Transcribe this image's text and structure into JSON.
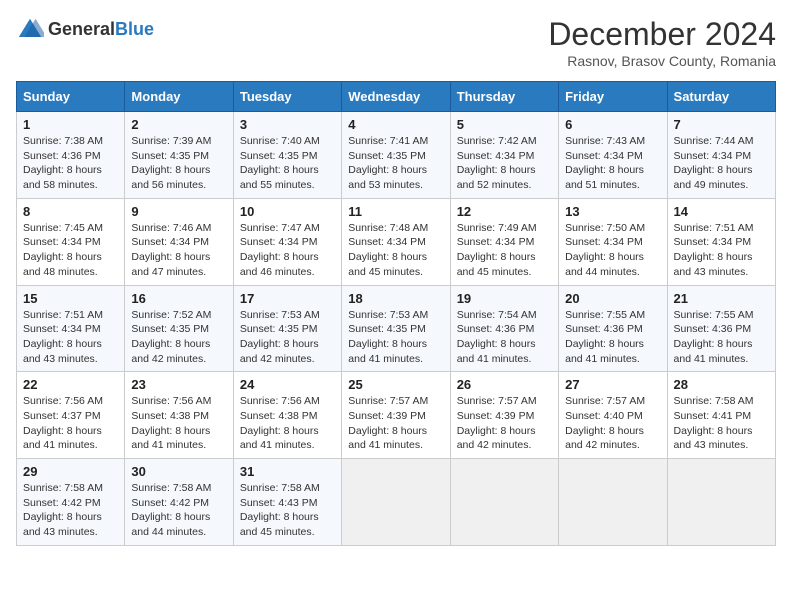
{
  "header": {
    "logo_general": "General",
    "logo_blue": "Blue",
    "month_title": "December 2024",
    "subtitle": "Rasnov, Brasov County, Romania"
  },
  "days_of_week": [
    "Sunday",
    "Monday",
    "Tuesday",
    "Wednesday",
    "Thursday",
    "Friday",
    "Saturday"
  ],
  "weeks": [
    [
      {
        "day": "1",
        "sunrise": "7:38 AM",
        "sunset": "4:36 PM",
        "daylight": "8 hours and 58 minutes."
      },
      {
        "day": "2",
        "sunrise": "7:39 AM",
        "sunset": "4:35 PM",
        "daylight": "8 hours and 56 minutes."
      },
      {
        "day": "3",
        "sunrise": "7:40 AM",
        "sunset": "4:35 PM",
        "daylight": "8 hours and 55 minutes."
      },
      {
        "day": "4",
        "sunrise": "7:41 AM",
        "sunset": "4:35 PM",
        "daylight": "8 hours and 53 minutes."
      },
      {
        "day": "5",
        "sunrise": "7:42 AM",
        "sunset": "4:34 PM",
        "daylight": "8 hours and 52 minutes."
      },
      {
        "day": "6",
        "sunrise": "7:43 AM",
        "sunset": "4:34 PM",
        "daylight": "8 hours and 51 minutes."
      },
      {
        "day": "7",
        "sunrise": "7:44 AM",
        "sunset": "4:34 PM",
        "daylight": "8 hours and 49 minutes."
      }
    ],
    [
      {
        "day": "8",
        "sunrise": "7:45 AM",
        "sunset": "4:34 PM",
        "daylight": "8 hours and 48 minutes."
      },
      {
        "day": "9",
        "sunrise": "7:46 AM",
        "sunset": "4:34 PM",
        "daylight": "8 hours and 47 minutes."
      },
      {
        "day": "10",
        "sunrise": "7:47 AM",
        "sunset": "4:34 PM",
        "daylight": "8 hours and 46 minutes."
      },
      {
        "day": "11",
        "sunrise": "7:48 AM",
        "sunset": "4:34 PM",
        "daylight": "8 hours and 45 minutes."
      },
      {
        "day": "12",
        "sunrise": "7:49 AM",
        "sunset": "4:34 PM",
        "daylight": "8 hours and 45 minutes."
      },
      {
        "day": "13",
        "sunrise": "7:50 AM",
        "sunset": "4:34 PM",
        "daylight": "8 hours and 44 minutes."
      },
      {
        "day": "14",
        "sunrise": "7:51 AM",
        "sunset": "4:34 PM",
        "daylight": "8 hours and 43 minutes."
      }
    ],
    [
      {
        "day": "15",
        "sunrise": "7:51 AM",
        "sunset": "4:34 PM",
        "daylight": "8 hours and 43 minutes."
      },
      {
        "day": "16",
        "sunrise": "7:52 AM",
        "sunset": "4:35 PM",
        "daylight": "8 hours and 42 minutes."
      },
      {
        "day": "17",
        "sunrise": "7:53 AM",
        "sunset": "4:35 PM",
        "daylight": "8 hours and 42 minutes."
      },
      {
        "day": "18",
        "sunrise": "7:53 AM",
        "sunset": "4:35 PM",
        "daylight": "8 hours and 41 minutes."
      },
      {
        "day": "19",
        "sunrise": "7:54 AM",
        "sunset": "4:36 PM",
        "daylight": "8 hours and 41 minutes."
      },
      {
        "day": "20",
        "sunrise": "7:55 AM",
        "sunset": "4:36 PM",
        "daylight": "8 hours and 41 minutes."
      },
      {
        "day": "21",
        "sunrise": "7:55 AM",
        "sunset": "4:36 PM",
        "daylight": "8 hours and 41 minutes."
      }
    ],
    [
      {
        "day": "22",
        "sunrise": "7:56 AM",
        "sunset": "4:37 PM",
        "daylight": "8 hours and 41 minutes."
      },
      {
        "day": "23",
        "sunrise": "7:56 AM",
        "sunset": "4:38 PM",
        "daylight": "8 hours and 41 minutes."
      },
      {
        "day": "24",
        "sunrise": "7:56 AM",
        "sunset": "4:38 PM",
        "daylight": "8 hours and 41 minutes."
      },
      {
        "day": "25",
        "sunrise": "7:57 AM",
        "sunset": "4:39 PM",
        "daylight": "8 hours and 41 minutes."
      },
      {
        "day": "26",
        "sunrise": "7:57 AM",
        "sunset": "4:39 PM",
        "daylight": "8 hours and 42 minutes."
      },
      {
        "day": "27",
        "sunrise": "7:57 AM",
        "sunset": "4:40 PM",
        "daylight": "8 hours and 42 minutes."
      },
      {
        "day": "28",
        "sunrise": "7:58 AM",
        "sunset": "4:41 PM",
        "daylight": "8 hours and 43 minutes."
      }
    ],
    [
      {
        "day": "29",
        "sunrise": "7:58 AM",
        "sunset": "4:42 PM",
        "daylight": "8 hours and 43 minutes."
      },
      {
        "day": "30",
        "sunrise": "7:58 AM",
        "sunset": "4:42 PM",
        "daylight": "8 hours and 44 minutes."
      },
      {
        "day": "31",
        "sunrise": "7:58 AM",
        "sunset": "4:43 PM",
        "daylight": "8 hours and 45 minutes."
      },
      null,
      null,
      null,
      null
    ]
  ],
  "labels": {
    "sunrise": "Sunrise:",
    "sunset": "Sunset:",
    "daylight": "Daylight:"
  }
}
